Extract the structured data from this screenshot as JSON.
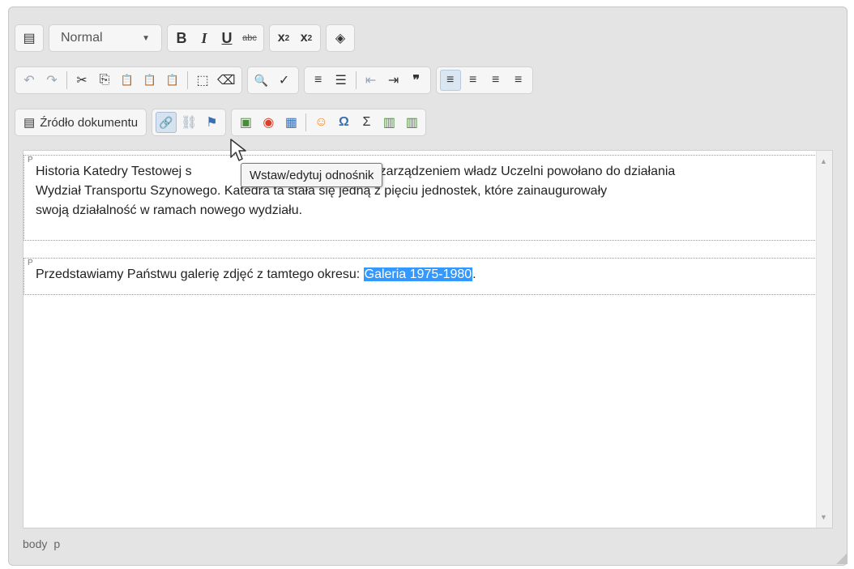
{
  "toolbar": {
    "row1": {
      "templates_icon": "▤",
      "format_value": "Normal",
      "format_caret": "▼",
      "bold": "B",
      "italic": "I",
      "underline": "U",
      "strike": "abc",
      "subscript_base": "x",
      "subscript_mark": "2",
      "superscript_base": "x",
      "superscript_mark": "2",
      "maximize_icon": "◈"
    },
    "row2": {
      "undo": "↶",
      "redo": "↷",
      "cut": "✂",
      "copy": "⎘",
      "paste": "📋",
      "paste_text": "📋",
      "paste_word": "📋",
      "select_all": "⬚",
      "remove_format": "⌫",
      "find": "🔍",
      "spell": "✓",
      "ol": "≡",
      "ul": "☰",
      "outdent": "⇤",
      "indent": "⇥",
      "blockquote": "❞",
      "align_left": "≡",
      "align_center": "≡",
      "align_right": "≡",
      "justify": "≡"
    },
    "row3": {
      "source_icon": "▤",
      "source_label": "Źródło dokumentu",
      "link": "🔗",
      "unlink": "⛓",
      "anchor": "⚑",
      "image": "▣",
      "flash": "◉",
      "table": "▦",
      "smiley": "☺",
      "special_char": "Ω",
      "math": "Σ",
      "media1": "▥",
      "media2": "▥"
    }
  },
  "content": {
    "paragraphs": [
      {
        "tag": "P",
        "line1_a": "Historia Katedry Testowej s",
        "line1_b": "zarządzeniem władz Uczelni powołano do działania",
        "line2": "Wydział Transportu Szynowego. Katedra ta stała się jedną z pięciu jednostek, które zainaugurowały",
        "line3": "swoją działalność w ramach nowego wydziału."
      },
      {
        "tag": "P",
        "before": "Przedstawiamy Państwu galerię zdjęć z tamtego okresu: ",
        "link_text": "Galeria 1975-1980",
        "after": "."
      }
    ]
  },
  "tooltip": "Wstaw/edytuj odnośnik",
  "statusbar": {
    "path": [
      "body",
      "p"
    ]
  }
}
